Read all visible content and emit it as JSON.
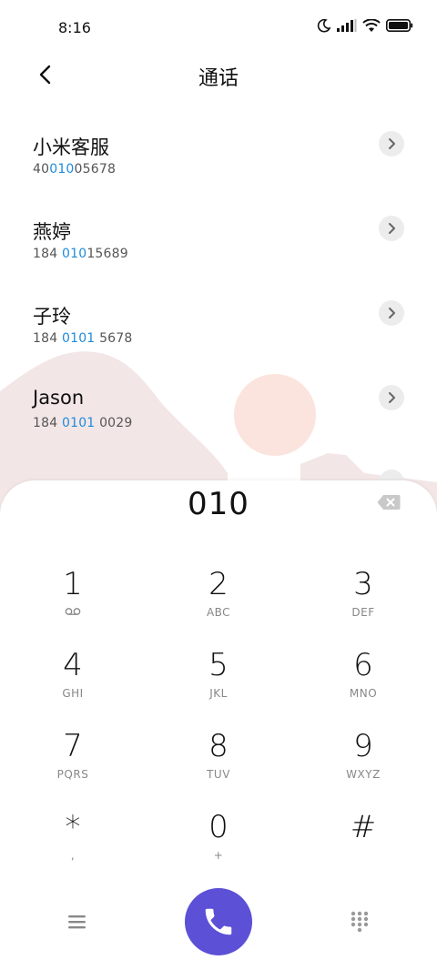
{
  "status_bar": {
    "time": "8:16"
  },
  "header": {
    "title": "通话"
  },
  "contacts": [
    {
      "name": "小米客服",
      "num_pre": "40",
      "num_hl": "010",
      "num_post": "05678"
    },
    {
      "name": "燕婷",
      "num_pre": "184 ",
      "num_hl": "010",
      "num_post": "15689"
    },
    {
      "name": "子玲",
      "num_pre": "184 ",
      "num_hl": "0101",
      "num_post": " 5678"
    },
    {
      "name": "Jason",
      "num_pre": "184 ",
      "num_hl": "0101",
      "num_post": " 0029"
    }
  ],
  "dialpad": {
    "entered": "010",
    "keys": [
      {
        "digit": "1",
        "sub": ""
      },
      {
        "digit": "2",
        "sub": "ABC"
      },
      {
        "digit": "3",
        "sub": "DEF"
      },
      {
        "digit": "4",
        "sub": "GHI"
      },
      {
        "digit": "5",
        "sub": "JKL"
      },
      {
        "digit": "6",
        "sub": "MNO"
      },
      {
        "digit": "7",
        "sub": "PQRS"
      },
      {
        "digit": "8",
        "sub": "TUV"
      },
      {
        "digit": "9",
        "sub": "WXYZ"
      },
      {
        "digit": "*",
        "sub": ","
      },
      {
        "digit": "0",
        "sub": "+"
      },
      {
        "digit": "#",
        "sub": ""
      }
    ]
  },
  "colors": {
    "highlight": "#1e8bdc",
    "call_button": "#5b50d6"
  },
  "icons": [
    "moon-icon",
    "signal-icon",
    "wifi-icon",
    "battery-icon",
    "back-icon",
    "chevron-right-icon",
    "backspace-icon",
    "voicemail-icon",
    "menu-icon",
    "phone-icon",
    "dialpad-grid-icon"
  ]
}
